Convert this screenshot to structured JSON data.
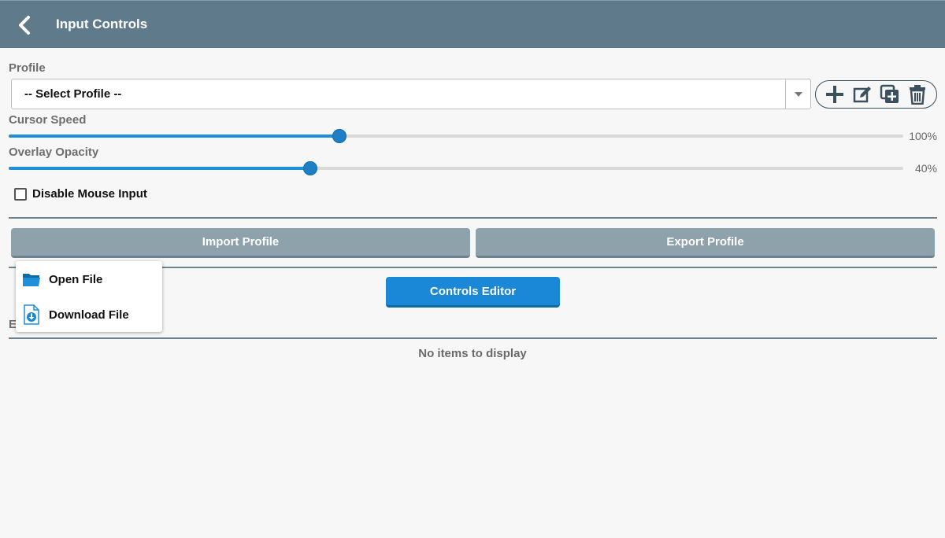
{
  "header": {
    "title": "Input Controls"
  },
  "profile": {
    "label": "Profile",
    "selected": "-- Select Profile --"
  },
  "toolbar": {
    "icons": [
      "plus-icon",
      "edit-icon",
      "duplicate-icon",
      "trash-icon"
    ]
  },
  "cursor_speed": {
    "label": "Cursor Speed",
    "value_text": "100%",
    "fill_fraction": 0.37
  },
  "overlay_opacity": {
    "label": "Overlay Opacity",
    "value_text": "40%",
    "fill_fraction": 0.337
  },
  "disable_mouse": {
    "label": "Disable Mouse Input",
    "checked": false
  },
  "buttons": {
    "import": "Import Profile",
    "export": "Export Profile",
    "controls_editor": "Controls Editor"
  },
  "list": {
    "partial_label": "E",
    "empty_text": "No items to display"
  },
  "popup_menu": {
    "items": [
      {
        "label": "Open File",
        "icon": "folder-icon"
      },
      {
        "label": "Download File",
        "icon": "download-file-icon"
      }
    ]
  },
  "colors": {
    "appbar": "#5f7a8a",
    "accent": "#1a88d6",
    "secondary_button": "#8ea2ac"
  }
}
